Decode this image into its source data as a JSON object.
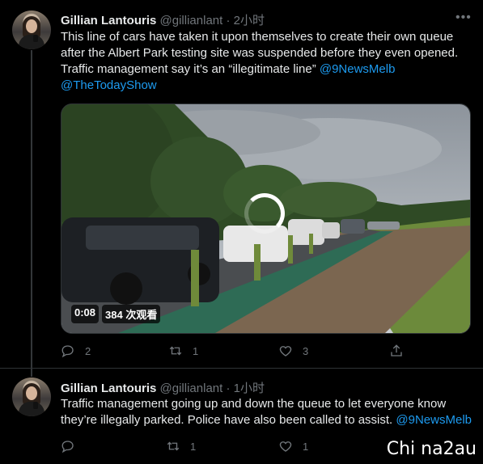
{
  "tweets": [
    {
      "name": "Gillian Lantouris",
      "handle": "@gillianlant",
      "separator": "·",
      "time": "2小时",
      "text_line1": "This line of cars have taken it upon themselves to create their own queue",
      "text_line2": "after the Albert Park testing site was suspended before they even opened.",
      "text_line3": "Traffic management say it’s an “illegitimate line” ",
      "mention1": "@9NewsMelb",
      "mention2": "@TheTodayShow",
      "video_time": "0:08",
      "video_views": "384 次观看",
      "reply_count": "2",
      "retweet_count": "1",
      "like_count": "3"
    },
    {
      "name": "Gillian Lantouris",
      "handle": "@gillianlant",
      "separator": "·",
      "time": "1小时",
      "text_line1": "Traffic management going up and down the queue to let everyone know",
      "text_line2": "they’re illegally parked. Police have also been called to assist. ",
      "mention1": "@9NewsMelb",
      "reply_count": "",
      "retweet_count": "1",
      "like_count": "1"
    }
  ],
  "more_icon": "more-horizontal-icon",
  "watermark": "Chi na2au",
  "colors": {
    "background": "#000000",
    "text": "#e7e9ea",
    "secondary": "#71767b",
    "link": "#1d9bf0"
  }
}
